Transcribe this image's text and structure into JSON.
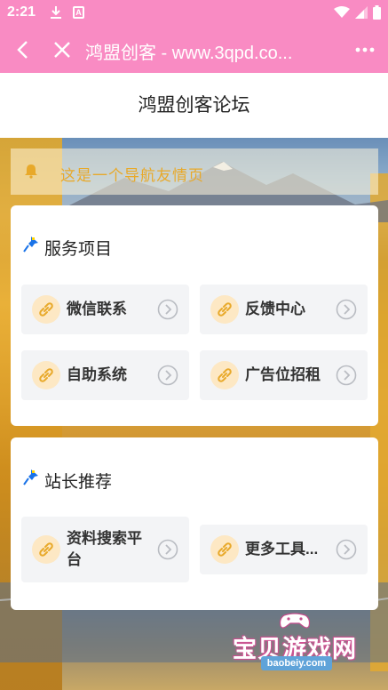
{
  "status_bar": {
    "time": "2:21",
    "download_icon": "download-icon",
    "app_icon_letter": "A"
  },
  "app_bar": {
    "title": "鸿盟创客 - www.3qpd.co..."
  },
  "page": {
    "heading": "鸿盟创客论坛"
  },
  "notice": {
    "text": "这是一个导航友情页"
  },
  "sections": [
    {
      "title": "服务项目",
      "items": [
        {
          "label": "微信联系"
        },
        {
          "label": "反馈中心"
        },
        {
          "label": "自助系统"
        },
        {
          "label": "广告位招租"
        }
      ]
    },
    {
      "title": "站长推荐",
      "items": [
        {
          "label": "资料搜索平台"
        },
        {
          "label": "更多工具..."
        }
      ]
    }
  ],
  "watermark": {
    "brand": "宝贝游戏网",
    "url": "baobeiy.com"
  },
  "colors": {
    "accent": "#f98bc3",
    "link_circle": "#fde8c4",
    "link_icon": "#e8a92a",
    "pin": "#1a73e8",
    "item_bg": "#f3f4f6"
  }
}
